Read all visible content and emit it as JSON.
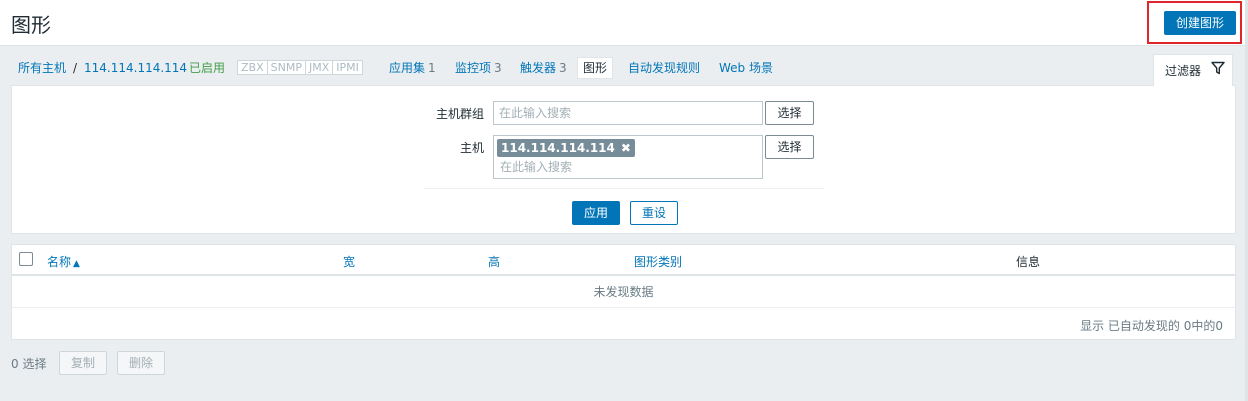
{
  "header": {
    "title": "图形",
    "create_button": "创建图形"
  },
  "breadcrumb": {
    "all_hosts": "所有主机",
    "separator": "/",
    "host": "114.114.114.114",
    "status": "已启用",
    "interfaces": [
      "ZBX",
      "SNMP",
      "JMX",
      "IPMI"
    ]
  },
  "nav": {
    "applications": {
      "label": "应用集",
      "count": "1"
    },
    "items": {
      "label": "监控项",
      "count": "3"
    },
    "triggers": {
      "label": "触发器",
      "count": "3"
    },
    "graphs": {
      "label": "图形"
    },
    "discovery": {
      "label": "自动发现规则"
    },
    "web": {
      "label": "Web 场景"
    }
  },
  "filter": {
    "tab_label": "过滤器",
    "host_groups_label": "主机群组",
    "host_groups_placeholder": "在此输入搜索",
    "hosts_label": "主机",
    "host_chip": "114.114.114.114",
    "hosts_placeholder": "在此输入搜索",
    "select_label": "选择",
    "apply_label": "应用",
    "reset_label": "重设"
  },
  "table": {
    "columns": {
      "name": "名称",
      "width": "宽",
      "height": "高",
      "graph_type": "图形类别",
      "info": "信息"
    },
    "empty_text": "未发现数据",
    "paging_text": "显示 已自动发现的 0中的0"
  },
  "footer": {
    "selected": "0 选择",
    "copy": "复制",
    "delete": "删除"
  },
  "colors": {
    "accent": "#0275b8",
    "enabled": "#429e47",
    "highlight_border": "#e0252b"
  }
}
